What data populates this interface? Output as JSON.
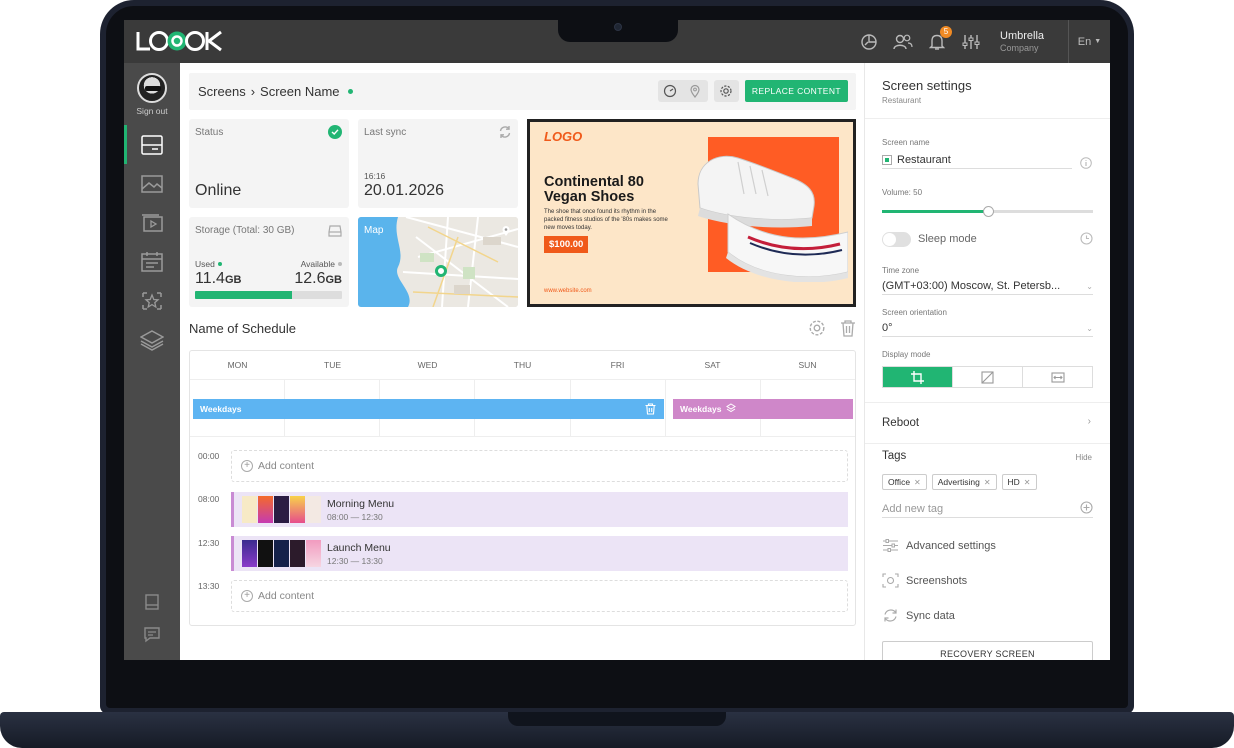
{
  "topbar": {
    "notification_count": "5",
    "company_name": "Umbrella",
    "company_sub": "Company",
    "language": "En",
    "icons": [
      "analytics-icon",
      "users-icon",
      "bell-icon",
      "sliders-icon"
    ]
  },
  "sidebar": {
    "signout_label": "Sign out",
    "items": [
      "screens-icon",
      "images-icon",
      "videos-icon",
      "calendar-icon",
      "star-icon",
      "layers-icon"
    ],
    "bottom": [
      "book-icon",
      "chat-icon"
    ]
  },
  "header": {
    "breadcrumb_root": "Screens",
    "breadcrumb_sep": "›",
    "breadcrumb_current": "Screen Name",
    "replace_label": "REPLACE CONTENT"
  },
  "status": {
    "label": "Status",
    "value": "Online"
  },
  "sync": {
    "label": "Last sync",
    "time": "16:16",
    "date": "20.01.2026"
  },
  "storage": {
    "label": "Storage (Total: 30 GB)",
    "used_label": "Used",
    "used_value": "11.4",
    "available_label": "Available",
    "available_value": "12.6",
    "unit": "GB",
    "used_fraction": 0.66
  },
  "map": {
    "label": "Map"
  },
  "promo": {
    "logo": "LOGO",
    "title": "Continental 80 Vegan Shoes",
    "description": "The shoe that once found its rhythm in the packed fitness studios of the '80s makes some new moves today.",
    "price": "$100.00",
    "website": "www.website.com"
  },
  "schedule": {
    "title": "Name of Schedule",
    "days": [
      "MON",
      "TUE",
      "WED",
      "THU",
      "FRI",
      "SAT",
      "SUN"
    ],
    "weekdays_label": "Weekdays",
    "weekend_label": "Weekdays",
    "add_content_label": "Add content",
    "slots": [
      {
        "time": "00:00"
      },
      {
        "time": "08:00",
        "title": "Morning Menu",
        "range": "08:00 — 12:30"
      },
      {
        "time": "12:30",
        "title": "Launch Menu",
        "range": "12:30 — 13:30"
      },
      {
        "time": "13:30"
      }
    ]
  },
  "settings": {
    "title": "Screen settings",
    "subtitle": "Restaurant",
    "screen_name_label": "Screen name",
    "screen_name_value": "Restaurant",
    "volume_label": "Volume:",
    "volume_value": "50",
    "volume_fraction": 0.5,
    "sleep_label": "Sleep mode",
    "timezone_label": "Time zone",
    "timezone_value": "(GMT+03:00) Moscow, St. Petersb...",
    "orientation_label": "Screen orientation",
    "orientation_value": "0°",
    "display_mode_label": "Display mode",
    "reboot_label": "Reboot",
    "tags_label": "Tags",
    "tags_hide": "Hide",
    "tags": [
      "Office",
      "Advertising",
      "HD"
    ],
    "new_tag_placeholder": "Add new tag",
    "advanced_label": "Advanced settings",
    "screenshots_label": "Screenshots",
    "sync_label": "Sync data",
    "recovery_label": "RECOVERY SCREEN"
  },
  "colors": {
    "accent": "#21b573",
    "topbar": "#3a3a3a",
    "sidebar": "#4a4a4a",
    "weekdays_bar": "#5db4f2",
    "weekend_bar": "#cf87c9",
    "promo_orange": "#f05a1a"
  }
}
